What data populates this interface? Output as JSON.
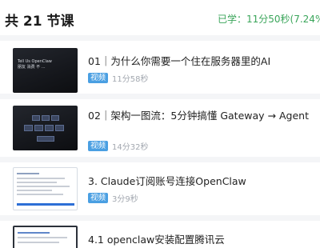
{
  "header": {
    "title": "共 21 节课",
    "progress": "已学：11分50秒(7.24%"
  },
  "lessons": [
    {
      "title": "01｜为什么你需要一个住在服务器里的AI",
      "badge": "视频",
      "duration": "11分58秒",
      "thumb_text": [
        "Tell Us OpenClaw",
        "朋友 消费 不 ..."
      ]
    },
    {
      "title": "02｜架构一图流：5分钟搞懂 Gateway → Agent",
      "badge": "视频",
      "duration": "14分32秒"
    },
    {
      "title": "3. Claude订阅账号连接OpenClaw",
      "badge": "视频",
      "duration": "3分9秒"
    },
    {
      "title": "4.1 openclaw安装配置腾讯云"
    }
  ]
}
